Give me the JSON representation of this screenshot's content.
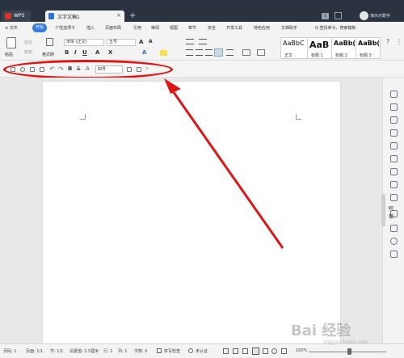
{
  "titlebar": {
    "wps_label": "WPS",
    "doc_tab_label": "文字文稿1",
    "doc_tab_close": "×",
    "new_tab": "+",
    "badge": "1",
    "user_label": "演示示数字"
  },
  "menubar": {
    "file": "≡ 文件",
    "start": "开始",
    "items": [
      "个性选项卡",
      "插入",
      "页面布局",
      "引用",
      "审阅",
      "视图",
      "章节",
      "安全",
      "开发工具",
      "特色应用",
      "文档助手"
    ],
    "search": "Q 查找命令、搜索模板"
  },
  "ribbon": {
    "paste": "粘贴",
    "cut": "剪切",
    "copy": "复制",
    "format_painter": "格式刷",
    "font_name": "宋体 (正文)",
    "font_size": "五号",
    "styles": [
      {
        "preview": "AaBbC",
        "caption": "正文"
      },
      {
        "preview": "AaB",
        "caption": "标题 1"
      },
      {
        "preview": "AaBb(",
        "caption": "标题 2"
      },
      {
        "preview": "AaBb(",
        "caption": "标题 3"
      }
    ]
  },
  "quickbar": {
    "font_size": "四号"
  },
  "sidebar": {
    "label": "阿锁"
  },
  "statusbar": {
    "page": "页码: 1",
    "pages": "页面: 1/1",
    "section": "节: 1/1",
    "setting": "设置值: 2.5厘米",
    "row": "行: 1",
    "col": "列: 1",
    "words": "字数: 0",
    "spell": "拼写检查",
    "cert": "未认证",
    "zoom": "100%"
  },
  "watermark": {
    "main": "Bai 经验",
    "sub": "jingyan.baidu.com"
  }
}
